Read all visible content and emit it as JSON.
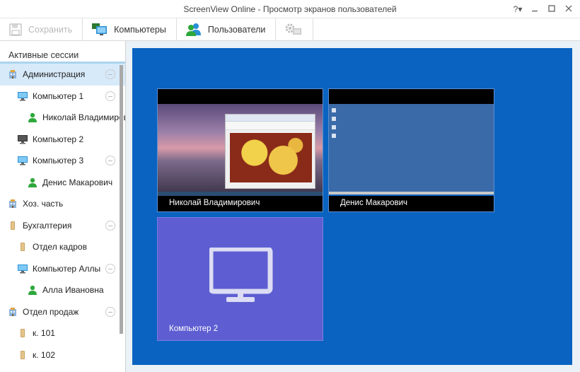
{
  "window": {
    "title": "ScreenView Online - Просмотр экранов пользователей",
    "help_label": "?▾"
  },
  "toolbar": {
    "save_label": "Сохранить",
    "computers_label": "Компьютеры",
    "users_label": "Пользователи"
  },
  "sidebar": {
    "header": "Активные сессии",
    "nodes": [
      {
        "label": "Администрация",
        "icon": "building-icon",
        "level": 0,
        "selected": true,
        "collapsible": true
      },
      {
        "label": "Компьютер 1",
        "icon": "monitor-blue-icon",
        "level": 1,
        "collapsible": true
      },
      {
        "label": "Николай Владимирович",
        "icon": "user-green-icon",
        "level": 2
      },
      {
        "label": "Компьютер 2",
        "icon": "monitor-dark-icon",
        "level": 1
      },
      {
        "label": "Компьютер 3",
        "icon": "monitor-blue-icon",
        "level": 1,
        "collapsible": true
      },
      {
        "label": "Денис Макарович",
        "icon": "user-green-icon",
        "level": 2
      },
      {
        "label": "Хоз. часть",
        "icon": "building-icon",
        "level": 0
      },
      {
        "label": "Бухгалтерия",
        "icon": "room-icon",
        "level": 0,
        "collapsible": true
      },
      {
        "label": "Отдел кадров",
        "icon": "room-icon",
        "level": 1
      },
      {
        "label": "Компьютер Аллы",
        "icon": "monitor-blue-icon",
        "level": 1,
        "collapsible": true
      },
      {
        "label": "Алла Ивановна",
        "icon": "user-green-icon",
        "level": 2
      },
      {
        "label": "Отдел продаж",
        "icon": "building-icon",
        "level": 0,
        "collapsible": true
      },
      {
        "label": "к. 101",
        "icon": "room-icon",
        "level": 1
      },
      {
        "label": "к. 102",
        "icon": "room-icon",
        "level": 1
      }
    ]
  },
  "tiles": {
    "t1_caption": "Николай Владимирович",
    "t2_caption": "Денис Макарович",
    "t3_caption": "Компьютер 2"
  },
  "colors": {
    "stage_bg": "#0a63c0",
    "offline_tile": "#5e5ed2",
    "selection": "#d7eafa",
    "user_icon": "#2ea83a",
    "monitor_icon": "#2b8fd6"
  }
}
